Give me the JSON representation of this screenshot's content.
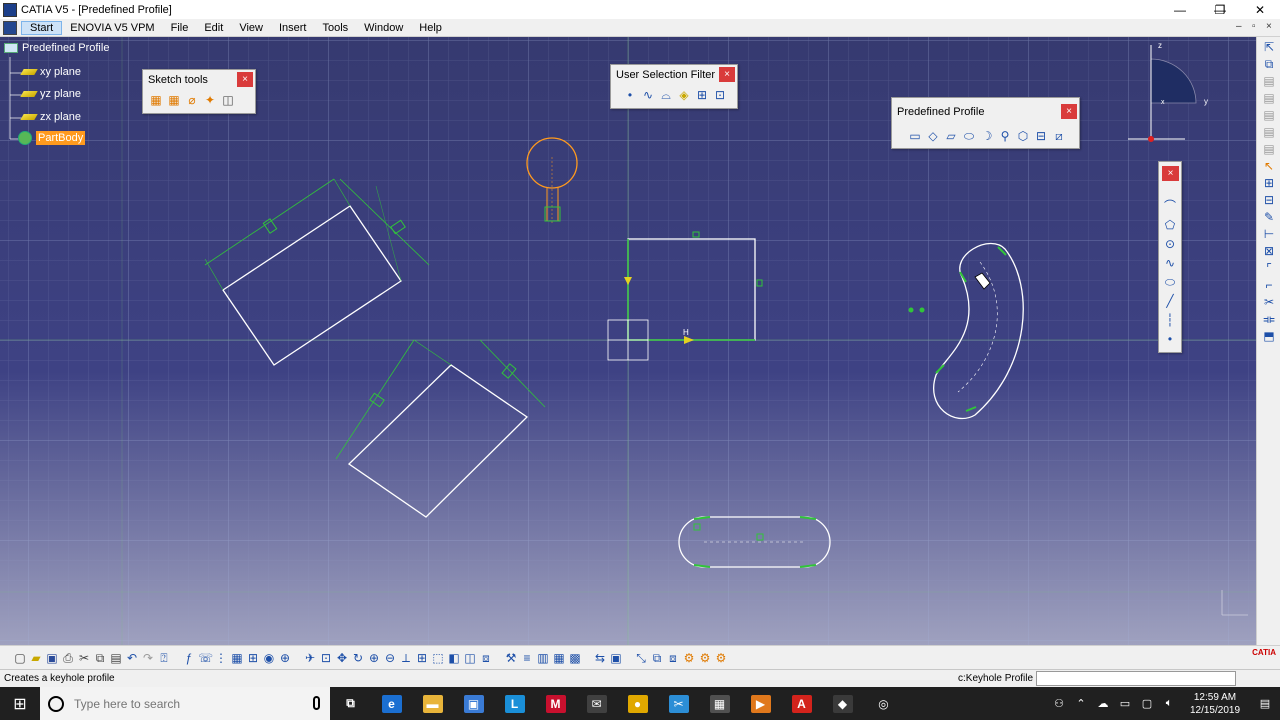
{
  "window": {
    "title": "CATIA V5 - [Predefined Profile]",
    "minimize": "—",
    "maximize": "❐",
    "close": "✕"
  },
  "menu": {
    "items": [
      "Start",
      "ENOVIA V5 VPM",
      "File",
      "Edit",
      "View",
      "Insert",
      "Tools",
      "Window",
      "Help"
    ],
    "mdi_minimize": "–",
    "mdi_restore": "▫",
    "mdi_close": "×"
  },
  "tree": {
    "root": "Predefined Profile",
    "items": [
      "xy plane",
      "yz plane",
      "zx plane"
    ],
    "body": "PartBody"
  },
  "toolbars": {
    "sketch_tools": {
      "title": "Sketch tools"
    },
    "user_selection_filter": {
      "title": "User Selection Filter"
    },
    "predefined_profile": {
      "title": "Predefined Profile"
    },
    "close_glyph": "×"
  },
  "compass": {
    "x_label": "x",
    "y_label": "y",
    "z_label": "z"
  },
  "sketch": {
    "h_label": "H",
    "v_label": "V"
  },
  "status": {
    "message": "Creates a keyhole profile",
    "command_label": "c:Keyhole Profile",
    "command_value": ""
  },
  "taskbar": {
    "search_placeholder": "Type here to search",
    "time": "12:59 AM",
    "date": "12/15/2019",
    "apps": [
      {
        "name": "task-view",
        "glyph": "⧉",
        "color": "#202020"
      },
      {
        "name": "edge",
        "glyph": "e",
        "color": "#1b6fd1"
      },
      {
        "name": "file-explorer",
        "glyph": "▬",
        "color": "#e8b43a"
      },
      {
        "name": "store",
        "glyph": "▣",
        "color": "#3a7bd5"
      },
      {
        "name": "l-app",
        "glyph": "L",
        "color": "#1a8fd8"
      },
      {
        "name": "mcafee",
        "glyph": "M",
        "color": "#c8102e"
      },
      {
        "name": "mail",
        "glyph": "✉",
        "color": "#404040"
      },
      {
        "name": "chrome",
        "glyph": "●",
        "color": "#e0a800"
      },
      {
        "name": "snip",
        "glyph": "✂",
        "color": "#2c8ed6"
      },
      {
        "name": "calculator",
        "glyph": "▦",
        "color": "#505050"
      },
      {
        "name": "media",
        "glyph": "▶",
        "color": "#e0781c"
      },
      {
        "name": "acrobat",
        "glyph": "A",
        "color": "#d3231c"
      },
      {
        "name": "catia",
        "glyph": "◆",
        "color": "#3a3a3a"
      },
      {
        "name": "recorder",
        "glyph": "◎",
        "color": "#202020"
      }
    ]
  },
  "colors": {
    "background_top": "#363a70",
    "background_bottom": "#9fa1bf",
    "sketch_white": "#ffffff",
    "constraint_green": "#31c43a",
    "highlight_orange": "#ff9a1e",
    "tree_highlight": "#ff9a1e"
  }
}
